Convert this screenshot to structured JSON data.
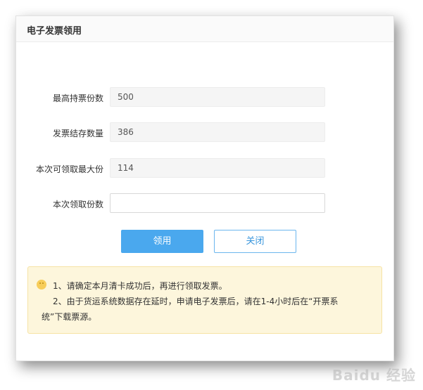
{
  "dialog": {
    "title": "电子发票领用",
    "fields": [
      {
        "label": "最高持票份数",
        "value": "500"
      },
      {
        "label": "发票结存数量",
        "value": "386"
      },
      {
        "label": "本次可领取最大份",
        "value": "114"
      },
      {
        "label": "本次领取份数",
        "value": ""
      }
    ],
    "buttons": {
      "confirm": "领用",
      "close": "关闭"
    },
    "notice": {
      "icon": "smile-icon",
      "line1": "1、请确定本月清卡成功后，再进行领取发票。",
      "line2": "2、由于货运系统数据存在延时，申请电子发票后，请在1-4小时后在“开票系",
      "line3": "统”下载票源。"
    }
  },
  "watermark": "Baidu 经验"
}
